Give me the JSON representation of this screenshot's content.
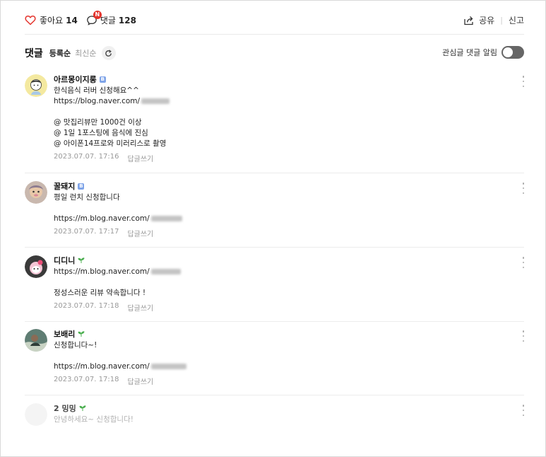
{
  "top_bar": {
    "like_label": "좋아요",
    "like_count": "14",
    "comment_label": "댓글",
    "comment_count": "128",
    "new_badge": "N",
    "share_label": "공유",
    "report_label": "신고",
    "divider": "|"
  },
  "header": {
    "title": "댓글",
    "sort_registered": "등록순",
    "sort_latest": "최신순",
    "alarm_label": "관심글 댓글 알림",
    "alarm_on": false
  },
  "comments": [
    {
      "nickname": "아르몽이지롱",
      "lines": [
        "한식음식 러버 신청해요^^",
        "https://blog.naver.com/",
        "",
        "@ 맛집리뷰만 1000건 이상",
        "@ 1일 1포스팅에 음식에 진심",
        "@ 아이폰14프로와 미러리스로 촬영"
      ],
      "date": "2023.07.07. 17:16",
      "reply": "답글쓰기"
    },
    {
      "nickname": "꿀돼지",
      "lines": [
        "평일 런치 신청합니다",
        "",
        "https://m.blog.naver.com/"
      ],
      "date": "2023.07.07. 17:17",
      "reply": "답글쓰기"
    },
    {
      "nickname": "디디니",
      "lines": [
        "https://m.blog.naver.com/",
        "",
        "정성스러운 리뷰 약속합니다 !"
      ],
      "date": "2023.07.07. 17:18",
      "reply": "답글쓰기"
    },
    {
      "nickname": "보배리",
      "lines": [
        "신청합니다~!",
        "",
        "https://m.blog.naver.com/"
      ],
      "date": "2023.07.07. 17:18",
      "reply": "답글쓰기"
    },
    {
      "nickname": "2 밍밍",
      "lines": [
        "안녕하세요~ 신청합니다!"
      ]
    }
  ],
  "colors": {
    "heart": "#e4332c",
    "badge_n": "#e4332c",
    "verified_badge": "#7fa4e8",
    "sprout": "#4caf50",
    "toggle_off": "#666666"
  },
  "icons": {
    "like": "heart-outline-icon",
    "comment": "speech-bubble-icon",
    "share": "share-icon",
    "refresh": "refresh-icon",
    "more": "more-vertical-icon",
    "verified": "blog-badge-icon",
    "sprout": "sprout-icon"
  }
}
